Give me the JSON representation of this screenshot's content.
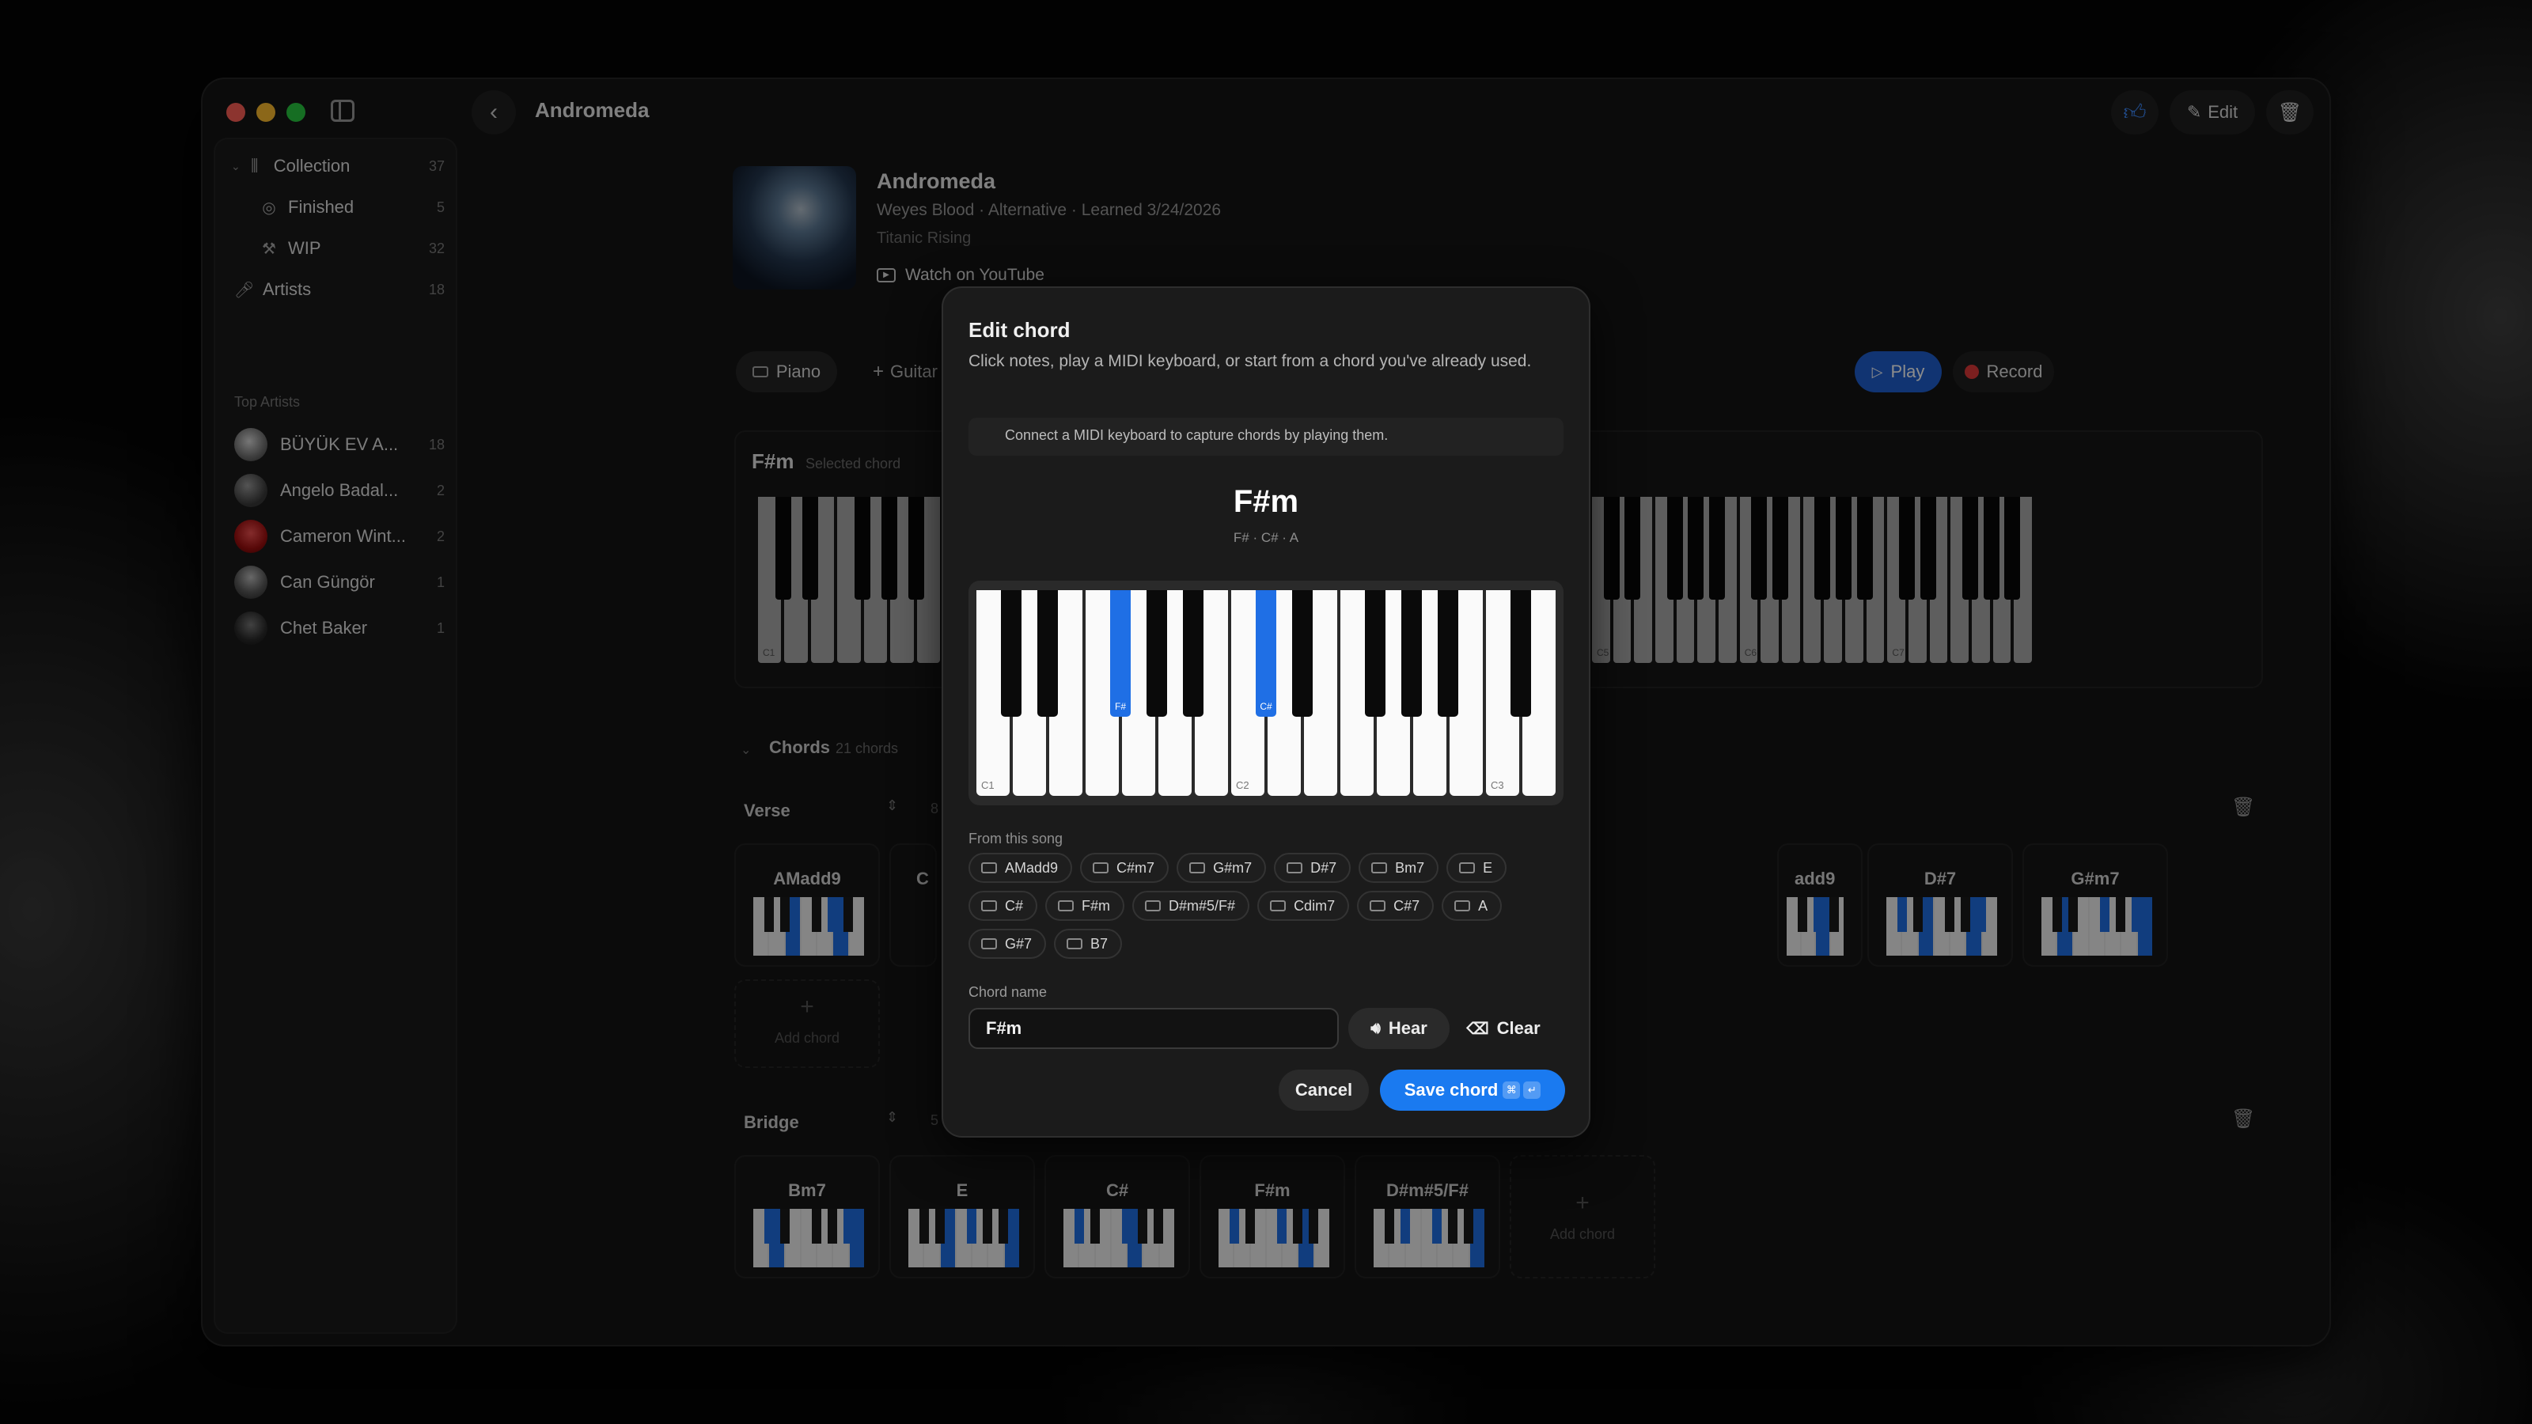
{
  "window": {
    "title": "Andromeda",
    "edit_label": "Edit"
  },
  "sidebar": {
    "items": [
      {
        "label": "Collection",
        "count": "37",
        "icon": "library-icon"
      },
      {
        "label": "Finished",
        "count": "5",
        "icon": "check-circle-icon"
      },
      {
        "label": "WIP",
        "count": "32",
        "icon": "hammer-icon"
      },
      {
        "label": "Artists",
        "count": "18",
        "icon": "microphone-icon"
      }
    ],
    "top_artists_heading": "Top Artists",
    "artists": [
      {
        "name": "BÜYÜK EV A...",
        "count": "18"
      },
      {
        "name": "Angelo Badal...",
        "count": "2"
      },
      {
        "name": "Cameron Wint...",
        "count": "2"
      },
      {
        "name": "Can Güngör",
        "count": "1"
      },
      {
        "name": "Chet Baker",
        "count": "1"
      }
    ]
  },
  "song": {
    "title": "Andromeda",
    "meta": "Weyes Blood · Alternative · Learned 3/24/2026",
    "album": "Titanic Rising",
    "youtube_label": "Watch on YouTube"
  },
  "instruments": {
    "piano": "Piano",
    "guitar": "Guitar"
  },
  "actions": {
    "play": "Play",
    "record": "Record"
  },
  "selected": {
    "chord": "F#m",
    "label": "Selected chord",
    "octaves_left": [
      "C1"
    ],
    "octaves_right": [
      "C5",
      "C6",
      "C7"
    ]
  },
  "chords_section": {
    "title": "Chords",
    "count": "21 chords"
  },
  "verse": {
    "title": "Verse",
    "count": "8",
    "chords": [
      "AMadd9",
      "C",
      "add9",
      "D#7",
      "G#m7"
    ],
    "add_label": "Add chord"
  },
  "bridge": {
    "title": "Bridge",
    "count": "5",
    "chords": [
      "Bm7",
      "E",
      "C#",
      "F#m",
      "D#m#5/F#"
    ],
    "add_label": "Add chord"
  },
  "modal": {
    "title": "Edit chord",
    "description": "Click notes, play a MIDI keyboard, or start from a chord you've already used.",
    "midi_hint": "Connect a MIDI keyboard to capture chords by playing them.",
    "chord": "F#m",
    "notes": "F# · C# · A",
    "key_labels": {
      "c1": "C1",
      "c2": "C2",
      "c3": "C3",
      "fs": "F#",
      "cs": "C#"
    },
    "from_song_label": "From this song",
    "song_chords": [
      "AMadd9",
      "C#m7",
      "G#m7",
      "D#7",
      "Bm7",
      "E",
      "C#",
      "F#m",
      "D#m#5/F#",
      "Cdim7",
      "C#7",
      "A",
      "G#7",
      "B7"
    ],
    "chord_name_label": "Chord name",
    "chord_name_value": "F#m",
    "hear": "Hear",
    "clear": "Clear",
    "cancel": "Cancel",
    "save": "Save chord",
    "save_shortcut": [
      "⌘",
      "↵"
    ]
  },
  "colors": {
    "accent": "#1f6fe5",
    "record": "#e03a3a",
    "bg": "#141414"
  }
}
